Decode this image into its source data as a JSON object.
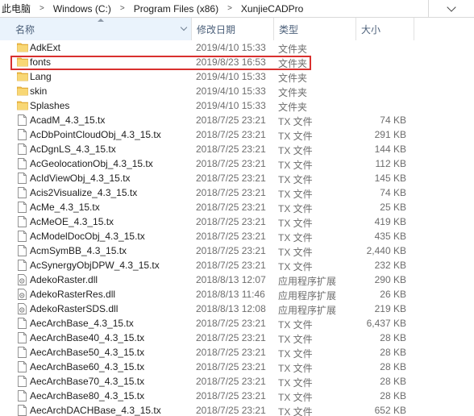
{
  "breadcrumb": [
    "此电脑",
    "Windows (C:)",
    "Program Files (x86)",
    "XunjieCADPro"
  ],
  "columns": {
    "name": "名称",
    "date": "修改日期",
    "type": "类型",
    "size": "大小"
  },
  "accent": {
    "highlight": "#d9302e",
    "folder": "#f3c14c",
    "header_bg": "#eaf3fc"
  },
  "rows": [
    {
      "icon": "folder-icon",
      "name": "AdkExt",
      "date": "2019/4/10 15:33",
      "type": "文件夹",
      "size": ""
    },
    {
      "icon": "folder-icon",
      "name": "fonts",
      "date": "2019/8/23 16:53",
      "type": "文件夹",
      "size": ""
    },
    {
      "icon": "folder-icon",
      "name": "Lang",
      "date": "2019/4/10 15:33",
      "type": "文件夹",
      "size": ""
    },
    {
      "icon": "folder-icon",
      "name": "skin",
      "date": "2019/4/10 15:33",
      "type": "文件夹",
      "size": ""
    },
    {
      "icon": "folder-icon",
      "name": "Splashes",
      "date": "2019/4/10 15:33",
      "type": "文件夹",
      "size": ""
    },
    {
      "icon": "file-icon",
      "name": "AcadM_4.3_15.tx",
      "date": "2018/7/25 23:21",
      "type": "TX 文件",
      "size": "74 KB"
    },
    {
      "icon": "file-icon",
      "name": "AcDbPointCloudObj_4.3_15.tx",
      "date": "2018/7/25 23:21",
      "type": "TX 文件",
      "size": "291 KB"
    },
    {
      "icon": "file-icon",
      "name": "AcDgnLS_4.3_15.tx",
      "date": "2018/7/25 23:21",
      "type": "TX 文件",
      "size": "144 KB"
    },
    {
      "icon": "file-icon",
      "name": "AcGeolocationObj_4.3_15.tx",
      "date": "2018/7/25 23:21",
      "type": "TX 文件",
      "size": "112 KB"
    },
    {
      "icon": "file-icon",
      "name": "AcIdViewObj_4.3_15.tx",
      "date": "2018/7/25 23:21",
      "type": "TX 文件",
      "size": "145 KB"
    },
    {
      "icon": "file-icon",
      "name": "Acis2Visualize_4.3_15.tx",
      "date": "2018/7/25 23:21",
      "type": "TX 文件",
      "size": "74 KB"
    },
    {
      "icon": "file-icon",
      "name": "AcMe_4.3_15.tx",
      "date": "2018/7/25 23:21",
      "type": "TX 文件",
      "size": "25 KB"
    },
    {
      "icon": "file-icon",
      "name": "AcMeOE_4.3_15.tx",
      "date": "2018/7/25 23:21",
      "type": "TX 文件",
      "size": "419 KB"
    },
    {
      "icon": "file-icon",
      "name": "AcModelDocObj_4.3_15.tx",
      "date": "2018/7/25 23:21",
      "type": "TX 文件",
      "size": "435 KB"
    },
    {
      "icon": "file-icon",
      "name": "AcmSymBB_4.3_15.tx",
      "date": "2018/7/25 23:21",
      "type": "TX 文件",
      "size": "2,440 KB"
    },
    {
      "icon": "file-icon",
      "name": "AcSynergyObjDPW_4.3_15.tx",
      "date": "2018/7/25 23:21",
      "type": "TX 文件",
      "size": "232 KB"
    },
    {
      "icon": "dll-icon",
      "name": "AdekoRaster.dll",
      "date": "2018/8/13 12:07",
      "type": "应用程序扩展",
      "size": "290 KB"
    },
    {
      "icon": "dll-icon",
      "name": "AdekoRasterRes.dll",
      "date": "2018/8/13 11:46",
      "type": "应用程序扩展",
      "size": "26 KB"
    },
    {
      "icon": "dll-icon",
      "name": "AdekoRasterSDS.dll",
      "date": "2018/8/13 12:08",
      "type": "应用程序扩展",
      "size": "219 KB"
    },
    {
      "icon": "file-icon",
      "name": "AecArchBase_4.3_15.tx",
      "date": "2018/7/25 23:21",
      "type": "TX 文件",
      "size": "6,437 KB"
    },
    {
      "icon": "file-icon",
      "name": "AecArchBase40_4.3_15.tx",
      "date": "2018/7/25 23:21",
      "type": "TX 文件",
      "size": "28 KB"
    },
    {
      "icon": "file-icon",
      "name": "AecArchBase50_4.3_15.tx",
      "date": "2018/7/25 23:21",
      "type": "TX 文件",
      "size": "28 KB"
    },
    {
      "icon": "file-icon",
      "name": "AecArchBase60_4.3_15.tx",
      "date": "2018/7/25 23:21",
      "type": "TX 文件",
      "size": "28 KB"
    },
    {
      "icon": "file-icon",
      "name": "AecArchBase70_4.3_15.tx",
      "date": "2018/7/25 23:21",
      "type": "TX 文件",
      "size": "28 KB"
    },
    {
      "icon": "file-icon",
      "name": "AecArchBase80_4.3_15.tx",
      "date": "2018/7/25 23:21",
      "type": "TX 文件",
      "size": "28 KB"
    },
    {
      "icon": "file-icon",
      "name": "AecArchDACHBase_4.3_15.tx",
      "date": "2018/7/25 23:21",
      "type": "TX 文件",
      "size": "652 KB"
    }
  ]
}
